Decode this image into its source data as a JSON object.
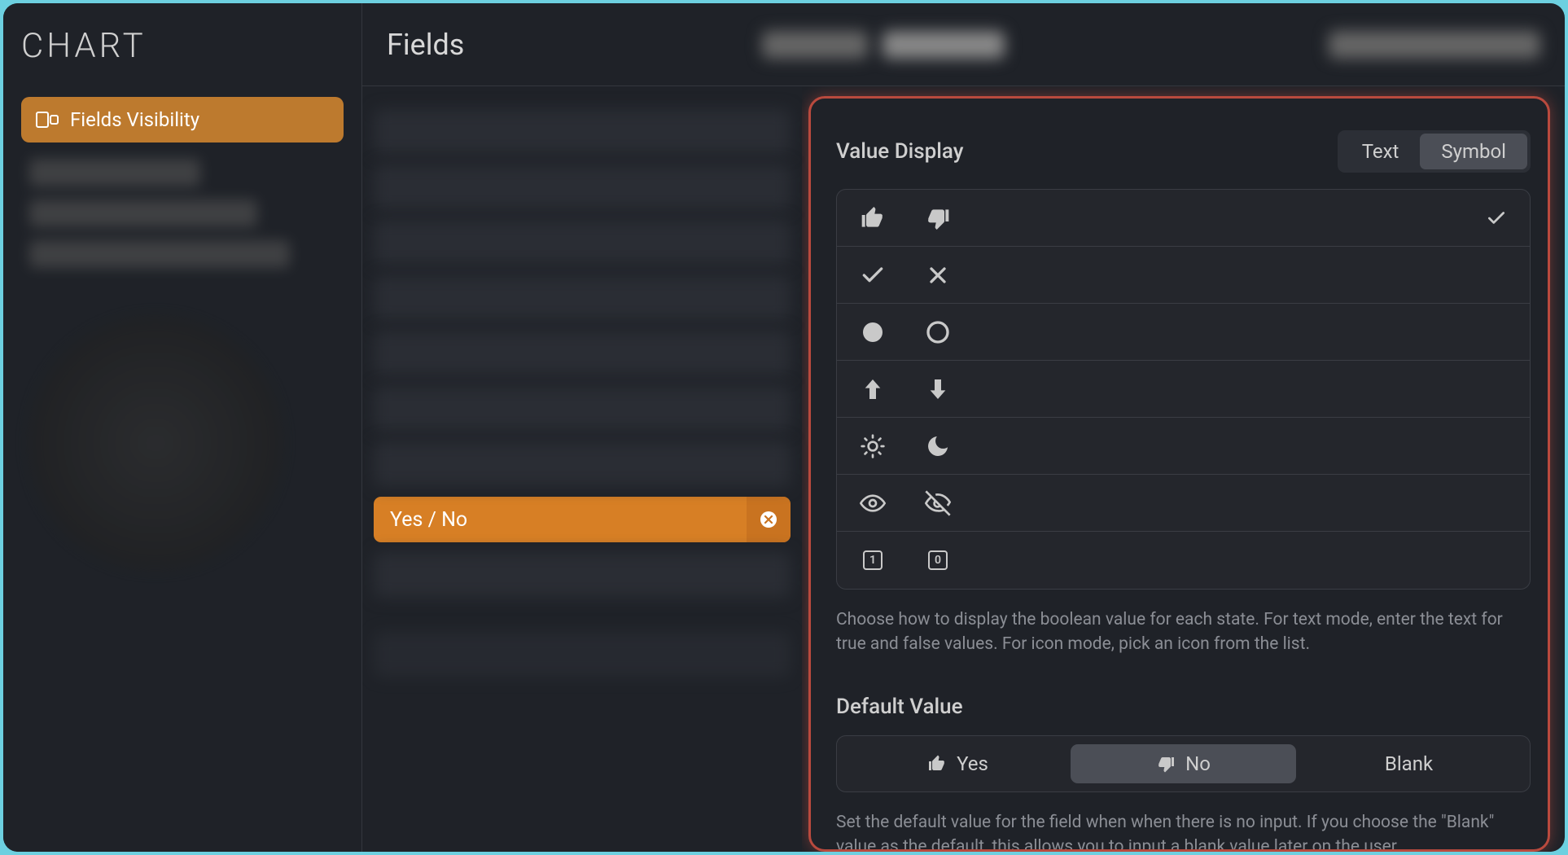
{
  "sidebar": {
    "title": "CHART",
    "items": [
      {
        "label": "Fields Visibility",
        "active": true
      }
    ]
  },
  "topbar": {
    "title": "Fields"
  },
  "selected_field": {
    "label": "Yes / No"
  },
  "panel": {
    "value_display": {
      "title": "Value Display",
      "seg": {
        "text": "Text",
        "symbol": "Symbol",
        "active": "symbol"
      },
      "rows": [
        {
          "id": "thumbs",
          "selected": true
        },
        {
          "id": "check-x"
        },
        {
          "id": "circles"
        },
        {
          "id": "arrows"
        },
        {
          "id": "sun-moon"
        },
        {
          "id": "eye"
        },
        {
          "id": "one-zero"
        }
      ],
      "help": "Choose how to display the boolean value for each state. For text mode, enter the text for true and false values. For icon mode, pick an icon from the list."
    },
    "default_value": {
      "title": "Default Value",
      "options": {
        "yes": "Yes",
        "no": "No",
        "blank": "Blank",
        "active": "no"
      },
      "help": "Set the default value for the field when when there is no input. If you choose the \"Blank\" value as the default, this allows you to input a blank value later on the user"
    }
  }
}
